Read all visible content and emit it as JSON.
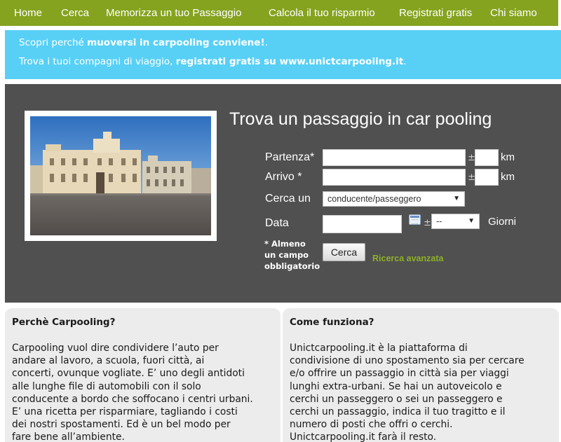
{
  "nav": {
    "items": [
      {
        "label": "Home"
      },
      {
        "label": "Cerca"
      },
      {
        "label": "Memorizza un tuo Passaggio"
      },
      {
        "label": "Calcola il tuo risparmio"
      },
      {
        "label": "Registrati gratis"
      },
      {
        "label": "Chi siamo"
      }
    ]
  },
  "banner": {
    "line1_prefix": "Scopri perché ",
    "line1_bold": "muoversi in carpooling conviene!",
    "line1_suffix": ".",
    "line2_prefix": "Trova i tuoi compagni di viaggio, ",
    "line2_bold": "registrati gratis su www.unictcarpooling.it",
    "line2_suffix": "."
  },
  "search": {
    "title": "Trova un passaggio in car pooling",
    "partenza_label": "Partenza*",
    "arrivo_label": "Arrivo *",
    "cerca_un_label": "Cerca un",
    "data_label": "Data",
    "plus_minus": "±",
    "km_unit": "km",
    "giorni_unit": "Giorni",
    "partenza_value": "",
    "partenza_km_value": "",
    "arrivo_value": "",
    "arrivo_km_value": "",
    "data_value": "",
    "role_selected": "conducente/passeggero",
    "days_selected": "--",
    "note_line1": "* Almeno",
    "note_line2": "un campo",
    "note_line3": "obbligatorio",
    "search_button": "Cerca",
    "advanced_link": "Ricerca avanzata"
  },
  "left_box": {
    "title": "Perchè Carpooling?",
    "lines": [
      "Carpooling vuol dire condividere l’auto per",
      "andare al lavoro, a scuola, fuori città, ai",
      "concerti, ovunque vogliate. E’ uno degli antidoti",
      "alle lunghe file di automobili con il solo",
      "conducente a bordo che soffocano i centri urbani.",
      "E’ una ricetta per risparmiare, tagliando i costi",
      "dei nostri spostamenti. Ed è un bel modo per",
      "fare bene all’ambiente."
    ]
  },
  "right_box": {
    "title": "Come funziona?",
    "lines": [
      "Unictcarpooling.it è la piattaforma di",
      "condivisione di uno spostamento sia per cercare",
      "e/o offrire un passaggio in città sia per viaggi",
      "lunghi extra-urbani. Se hai un autoveicolo e",
      "cerchi un passeggero o sei un passeggero e",
      "cerchi un passaggio, indica il tuo tragitto e il",
      "numero di posti che offri o cerchi.",
      "Unictcarpooling.it farà il resto."
    ]
  },
  "colors": {
    "nav": "#85a31f",
    "banner": "#58d0f6",
    "search_bg": "#505050",
    "box_bg": "#ececec",
    "link": "#8db028"
  }
}
